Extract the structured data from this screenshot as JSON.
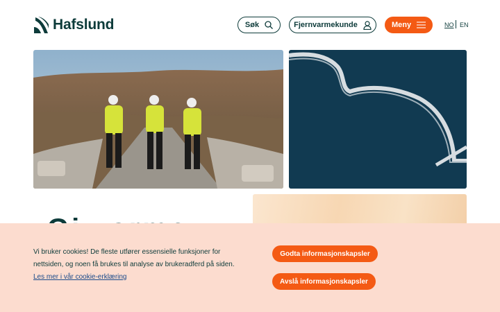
{
  "header": {
    "logo_text": "Hafslund",
    "search_label": "Søk",
    "customer_label": "Fjernvarmekunde",
    "menu_label": "Meny",
    "lang_no": "NO",
    "lang_en": "EN"
  },
  "main": {
    "partial_heading": "Gi varme"
  },
  "cookie_banner": {
    "text": "Vi bruker cookies! De fleste utfører essensielle funksjoner for nettsiden, og noen få brukes til analyse av brukeradferd på siden.",
    "link_text": "Les mer i vår cookie-erklæring",
    "accept_label": "Godta informasjonskapsler",
    "reject_label": "Avslå informasjonskapsler"
  },
  "colors": {
    "brand_dark": "#0d3b3a",
    "accent": "#f45a14",
    "cookie_bg": "#fcdccf"
  },
  "icons": {
    "logo": "hafslund-wave-logo",
    "search": "search-icon",
    "user": "user-icon",
    "menu": "hamburger-icon"
  }
}
